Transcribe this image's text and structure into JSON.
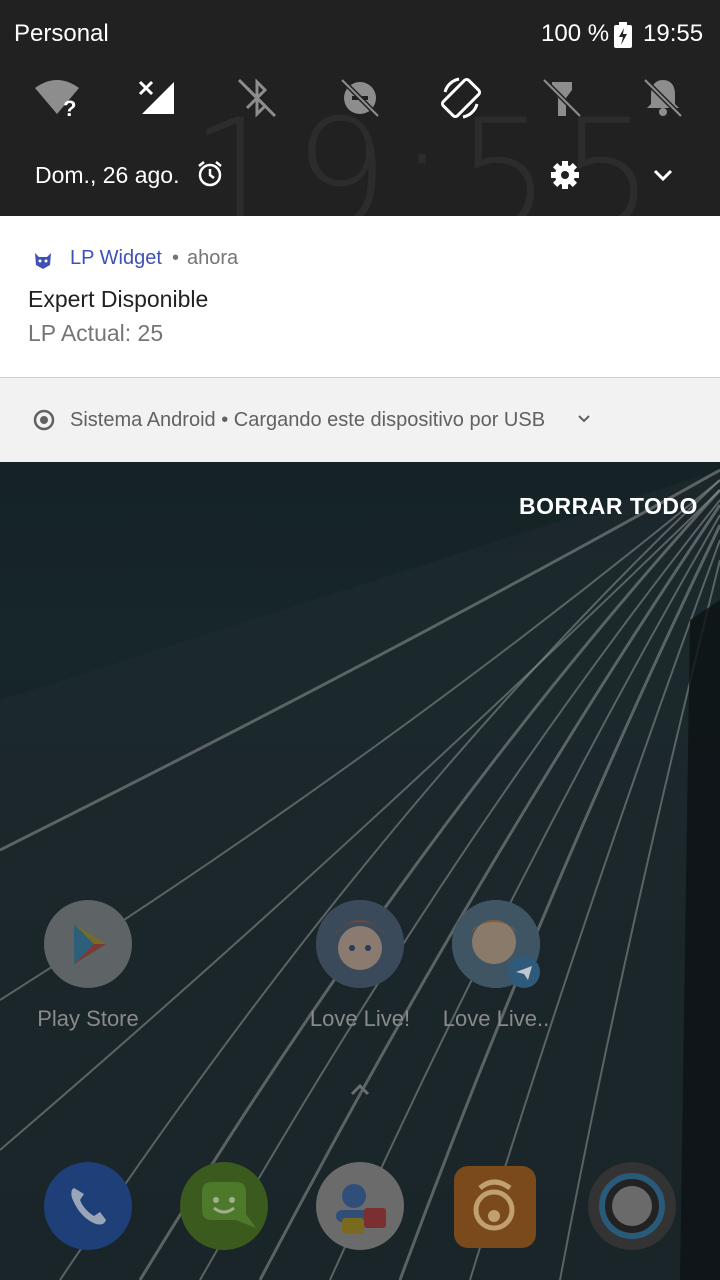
{
  "status_bar": {
    "carrier": "Personal",
    "battery_percent": "100 %",
    "time": "19:55",
    "icons": [
      "battery-charging-icon"
    ]
  },
  "quick_settings": {
    "background_clock": "19:55",
    "tiles": [
      {
        "name": "wifi-unknown-icon"
      },
      {
        "name": "mobile-data-off-icon"
      },
      {
        "name": "bluetooth-off-icon"
      },
      {
        "name": "data-saver-off-icon"
      },
      {
        "name": "auto-rotate-icon"
      },
      {
        "name": "flashlight-off-icon"
      },
      {
        "name": "do-not-disturb-icon"
      }
    ],
    "date": "Dom., 26 ago."
  },
  "notifications": [
    {
      "app_name": "LP Widget",
      "separator": "•",
      "time": "ahora",
      "title": "Expert Disponible",
      "text": "LP Actual: 25",
      "accent": "#3f51b5"
    },
    {
      "app_name": "Sistema Android",
      "separator": "•",
      "text": "Cargando este dispositivo por USB",
      "line": "Sistema Android • Cargando este dispositivo por USB"
    }
  ],
  "clear_all_label": "BORRAR TODO",
  "home": {
    "apps": [
      {
        "label": "Play Store"
      },
      {
        "label": "Love Live!"
      },
      {
        "label": "Love Live.."
      }
    ],
    "dock": [
      {
        "name": "phone-icon"
      },
      {
        "name": "messaging-icon"
      },
      {
        "name": "contacts-icon"
      },
      {
        "name": "uc-browser-icon"
      },
      {
        "name": "camera-icon"
      }
    ]
  }
}
